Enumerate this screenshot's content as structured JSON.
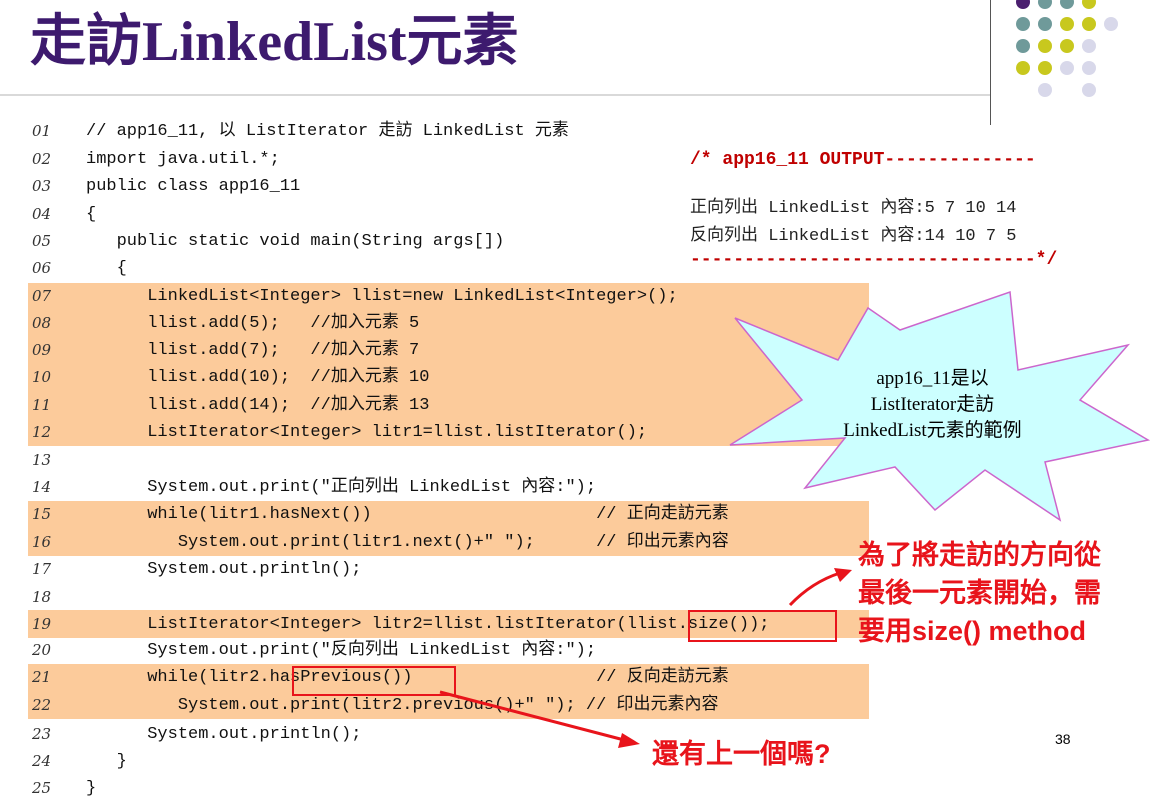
{
  "slide": {
    "title": "走訪LinkedList元素",
    "page_number": "38"
  },
  "code_lines": [
    {
      "num": "01",
      "text": "// app16_11, 以 ListIterator 走訪 LinkedList 元素"
    },
    {
      "num": "02",
      "text": "import java.util.*;"
    },
    {
      "num": "03",
      "text": "public class app16_11"
    },
    {
      "num": "04",
      "text": "{"
    },
    {
      "num": "05",
      "text": "   public static void main(String args[])"
    },
    {
      "num": "06",
      "text": "   {"
    },
    {
      "num": "07",
      "text": "      LinkedList<Integer> llist=new LinkedList<Integer>();"
    },
    {
      "num": "08",
      "text": "      llist.add(5);   //加入元素 5"
    },
    {
      "num": "09",
      "text": "      llist.add(7);   //加入元素 7"
    },
    {
      "num": "10",
      "text": "      llist.add(10);  //加入元素 10"
    },
    {
      "num": "11",
      "text": "      llist.add(14);  //加入元素 13"
    },
    {
      "num": "12",
      "text": "      ListIterator<Integer> litr1=llist.listIterator();"
    },
    {
      "num": "13",
      "text": ""
    },
    {
      "num": "14",
      "text": "      System.out.print(\"正向列出 LinkedList 內容:\");"
    },
    {
      "num": "15",
      "text": "      while(litr1.hasNext())                      // 正向走訪元素"
    },
    {
      "num": "16",
      "text": "         System.out.print(litr1.next()+\" \");      // 印出元素內容"
    },
    {
      "num": "17",
      "text": "      System.out.println();"
    },
    {
      "num": "18",
      "text": ""
    },
    {
      "num": "19",
      "text": "      ListIterator<Integer> litr2=llist.listIterator(llist.size());"
    },
    {
      "num": "20",
      "text": "      System.out.print(\"反向列出 LinkedList 內容:\");"
    },
    {
      "num": "21",
      "text": "      while(litr2.hasPrevious())                  // 反向走訪元素"
    },
    {
      "num": "22",
      "text": "         System.out.print(litr2.previous()+\" \"); // 印出元素內容"
    },
    {
      "num": "23",
      "text": "      System.out.println();"
    },
    {
      "num": "24",
      "text": "   }"
    },
    {
      "num": "25",
      "text": "}"
    }
  ],
  "output_box": {
    "header": "/* app16_11 OUTPUT--------------",
    "lines": [
      "正向列出 LinkedList 內容:5 7 10 14",
      "反向列出 LinkedList 內容:14 10 7 5"
    ],
    "footer": "--------------------------------*/"
  },
  "callouts": {
    "burst_lines": [
      "app16_11是以",
      "ListIterator走訪",
      "LinkedList元素的範例"
    ],
    "size_note_lines": [
      "為了將走訪的方向從",
      "最後一元素開始，需",
      "要用size() method"
    ],
    "previous_note": "還有上一個嗎?"
  },
  "colors": {
    "title": "#3d1a6e",
    "highlight": "#fccb9b",
    "burst_fill": "#ccffff",
    "annotation_red": "#e8141b",
    "dot_purple": "#4b1f6f",
    "dot_teal": "#6f9a9a",
    "dot_yellow": "#c8c81e",
    "dot_lavender": "#d8d8ea"
  }
}
